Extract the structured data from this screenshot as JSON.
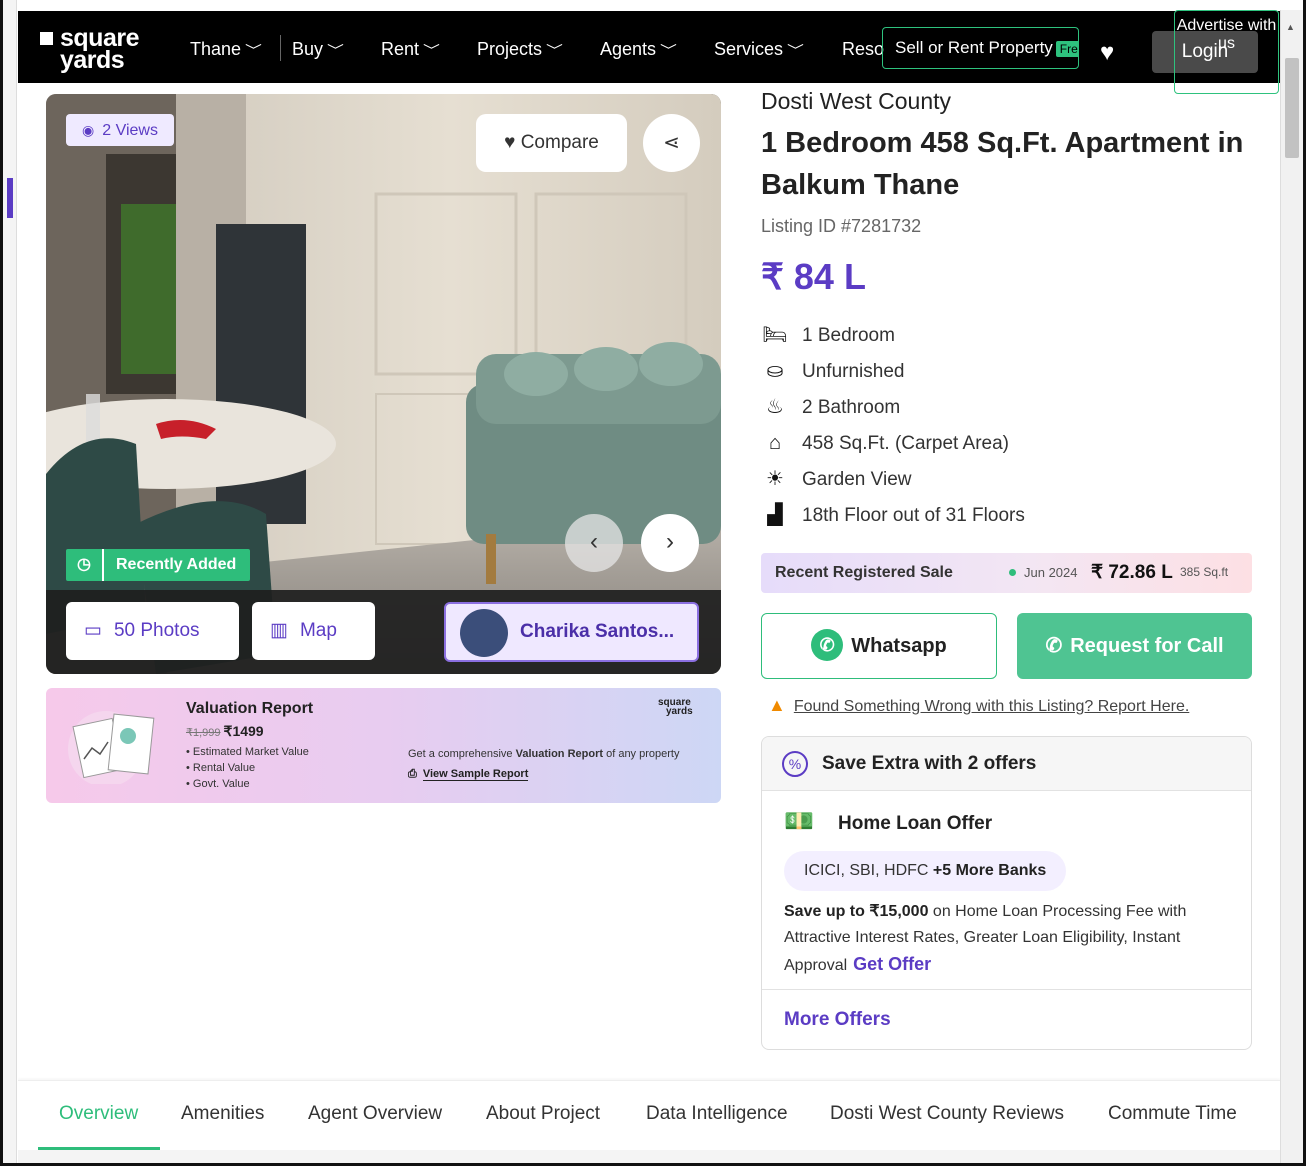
{
  "header": {
    "logo_line1": "square",
    "logo_line2": "yards",
    "nav": [
      {
        "label": "Thane"
      },
      {
        "label": "Buy"
      },
      {
        "label": "Rent"
      },
      {
        "label": "Projects"
      },
      {
        "label": "Agents"
      },
      {
        "label": "Services"
      },
      {
        "label": "Resources"
      }
    ],
    "sell_rent_label": "Sell or Rent Property",
    "sell_rent_badge": "Free",
    "data_intelligence_label": "Data Intelligence",
    "login_label": "Login",
    "advertise_label": "Advertise with us"
  },
  "gallery": {
    "views": "2 Views",
    "compare_label": "Compare",
    "recently_added": "Recently Added",
    "photos_label": "50 Photos",
    "map_label": "Map",
    "agent_name": "Charika Santos..."
  },
  "valuation": {
    "title": "Valuation Report",
    "old_price": "₹1,999",
    "price": "₹1499",
    "items": [
      "Estimated Market Value",
      "Rental Value",
      "Govt. Value"
    ],
    "desc_prefix": "Get a comprehensive",
    "desc_bold": "Valuation Report",
    "desc_suffix": "of any property",
    "sample_link": "View Sample Report",
    "logo_l1": "square",
    "logo_l2": "yards"
  },
  "listing": {
    "project_name": "Dosti West County",
    "title": "1 Bedroom 458 Sq.Ft. Apartment in Balkum Thane",
    "listing_id": "Listing ID #7281732",
    "price": "₹ 84 L",
    "features": [
      {
        "icon": "bed-icon",
        "label": "1 Bedroom"
      },
      {
        "icon": "sofa-icon",
        "label": "Unfurnished"
      },
      {
        "icon": "bathtub-icon",
        "label": "2 Bathroom"
      },
      {
        "icon": "home-icon",
        "label": "458 Sq.Ft. (Carpet Area)"
      },
      {
        "icon": "sunrise-icon",
        "label": "Garden View"
      },
      {
        "icon": "stairs-icon",
        "label": "18th Floor out of 31 Floors"
      }
    ]
  },
  "recent_sale": {
    "label": "Recent Registered Sale",
    "date": "Jun 2024",
    "price": "₹ 72.86 L",
    "area": "385 Sq.ft"
  },
  "actions": {
    "whatsapp_label": "Whatsapp",
    "call_label": "Request for Call",
    "report_text": "Found Something Wrong with this Listing? Report Here."
  },
  "offers": {
    "title": "Save Extra with 2 offers",
    "loan_title": "Home Loan Offer",
    "banks": "ICICI, SBI, HDFC",
    "banks_more": "+5 More Banks",
    "save_bold": "Save up to ₹15,000",
    "save_rest": "on Home Loan Processing Fee with Attractive Interest Rates, Greater Loan Eligibility, Instant Approval",
    "get_offer": "Get Offer",
    "more_offers": "More Offers"
  },
  "tabs": [
    {
      "label": "Overview",
      "active": true
    },
    {
      "label": "Amenities"
    },
    {
      "label": "Agent Overview"
    },
    {
      "label": "About Project"
    },
    {
      "label": "Data Intelligence"
    },
    {
      "label": "Dosti West County Reviews"
    },
    {
      "label": "Commute Time"
    }
  ],
  "colors": {
    "brand_purple": "#5b3cc4",
    "brand_green": "#2ebd7b",
    "header_bg": "#000000"
  }
}
